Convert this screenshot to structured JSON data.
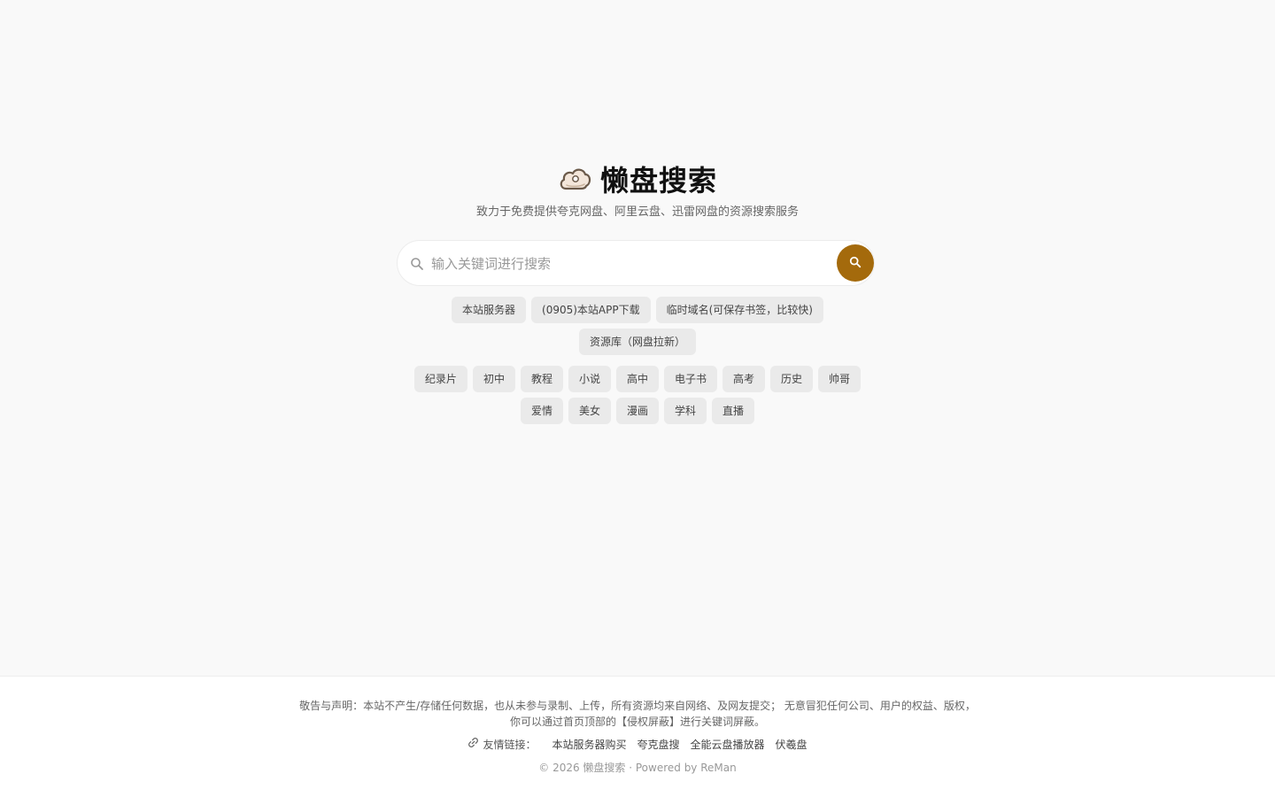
{
  "brand": {
    "title": "懒盘搜索",
    "tagline": "致力于免费提供夸克网盘、阿里云盘、迅雷网盘的资源搜索服务"
  },
  "search": {
    "placeholder": "输入关键词进行搜索",
    "value": "",
    "accent_color": "#a46a0c"
  },
  "quick_links": {
    "row1": [
      "本站服务器",
      "(0905)本站APP下载",
      "临时域名(可保存书签，比较快)"
    ],
    "row2": [
      "资源库（网盘拉新）"
    ]
  },
  "tags": {
    "row1": [
      "纪录片",
      "初中",
      "教程",
      "小说",
      "高中",
      "电子书",
      "高考",
      "历史",
      "帅哥"
    ],
    "row2": [
      "爱情",
      "美女",
      "漫画",
      "学科",
      "直播"
    ]
  },
  "footer": {
    "disclaimer_line1": "敬告与声明：本站不产生/存储任何数据，也从未参与录制、上传，所有资源均来自网络、及网友提交；  无意冒犯任何公司、用户的权益、版权，",
    "disclaimer_line2": "你可以通过首页顶部的【侵权屏蔽】进行关键词屏蔽。",
    "links_label": "友情链接：",
    "links": [
      "本站服务器购买",
      "夸克盘搜",
      "全能云盘播放器",
      "伏羲盘"
    ],
    "copyright": "© 2026 懒盘搜索 · Powered by  ReMan"
  }
}
